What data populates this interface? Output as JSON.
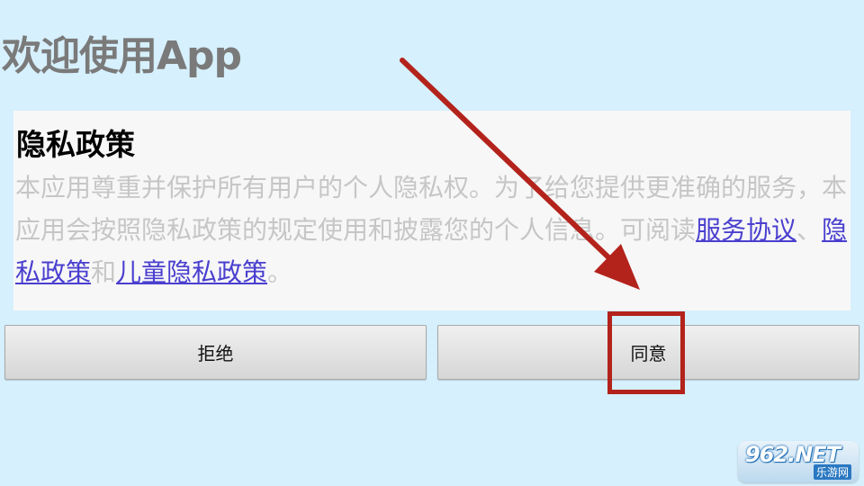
{
  "app_title": "欢迎使用App",
  "policy": {
    "title": "隐私政策",
    "body_intro": "本应用尊重并保护所有用户的个人隐私权。为了给您提供更准确的服务，本应用会按照隐私政策的规定使用和披露您的个人信息。可阅读",
    "link_service": "服务协议",
    "separator": "、",
    "link_privacy": "隐私政策",
    "conjunction": "和",
    "link_children": "儿童隐私政策",
    "ending": "。"
  },
  "buttons": {
    "refuse_label": "拒绝",
    "agree_label": "同意"
  },
  "annotation": {
    "color": "#b3231c"
  },
  "watermark": {
    "logo_text": "962.NET",
    "sub_text": "乐游网"
  },
  "colors": {
    "background": "#d6f0fd",
    "title_gray": "#7a7a7a",
    "link": "#4a3fcf",
    "body_text": "#c6c6c6"
  }
}
